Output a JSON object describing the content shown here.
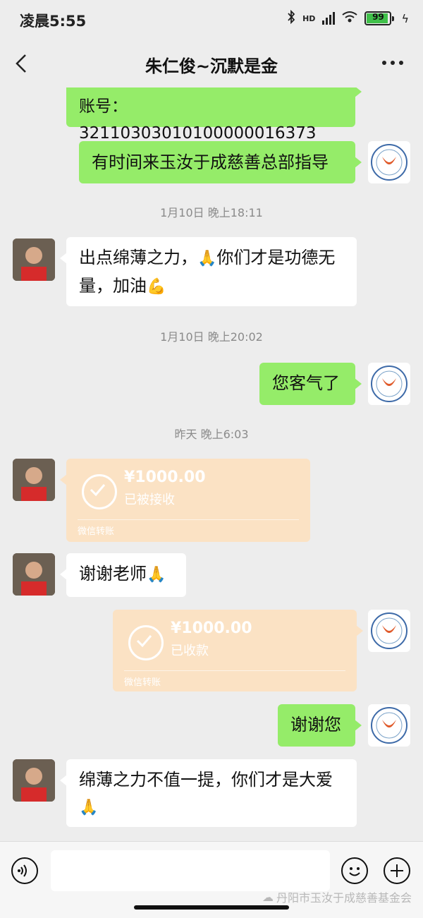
{
  "status_bar": {
    "time": "凌晨5:55",
    "network_label": "HD",
    "battery": "99"
  },
  "header": {
    "title": "朱仁俊~沉默是金"
  },
  "messages": [
    {
      "type": "text",
      "from": "me",
      "text": "账号：32110303010100000016373"
    },
    {
      "type": "text",
      "from": "me",
      "text": "有时间来玉汝于成慈善总部指导"
    },
    {
      "type": "timestamp",
      "text": "1月10日 晚上18:11"
    },
    {
      "type": "text",
      "from": "them",
      "line1": "出点绵薄之力，",
      "line1b": "你们才是功德无",
      "line2": "量，加油"
    },
    {
      "type": "timestamp",
      "text": "1月10日 晚上20:02"
    },
    {
      "type": "text",
      "from": "me",
      "text": "您客气了"
    },
    {
      "type": "timestamp",
      "text": "昨天 晚上6:03"
    },
    {
      "type": "transfer",
      "from": "them",
      "amount": "¥1000.00",
      "status": "已被接收",
      "footer": "微信转账"
    },
    {
      "type": "text",
      "from": "them",
      "text": "谢谢老师"
    },
    {
      "type": "transfer",
      "from": "me",
      "amount": "¥1000.00",
      "status": "已收款",
      "footer": "微信转账"
    },
    {
      "type": "text",
      "from": "me",
      "text": "谢谢您"
    },
    {
      "type": "text",
      "from": "them",
      "line1": "绵薄之力不值一提，你们才是大爱"
    }
  ],
  "watermark": "丹阳市玉汝于成慈善基金会",
  "colors": {
    "my_bubble": "#95ec69",
    "their_bubble": "#ffffff",
    "transfer": "#fbe2c4",
    "background": "#ededed"
  }
}
